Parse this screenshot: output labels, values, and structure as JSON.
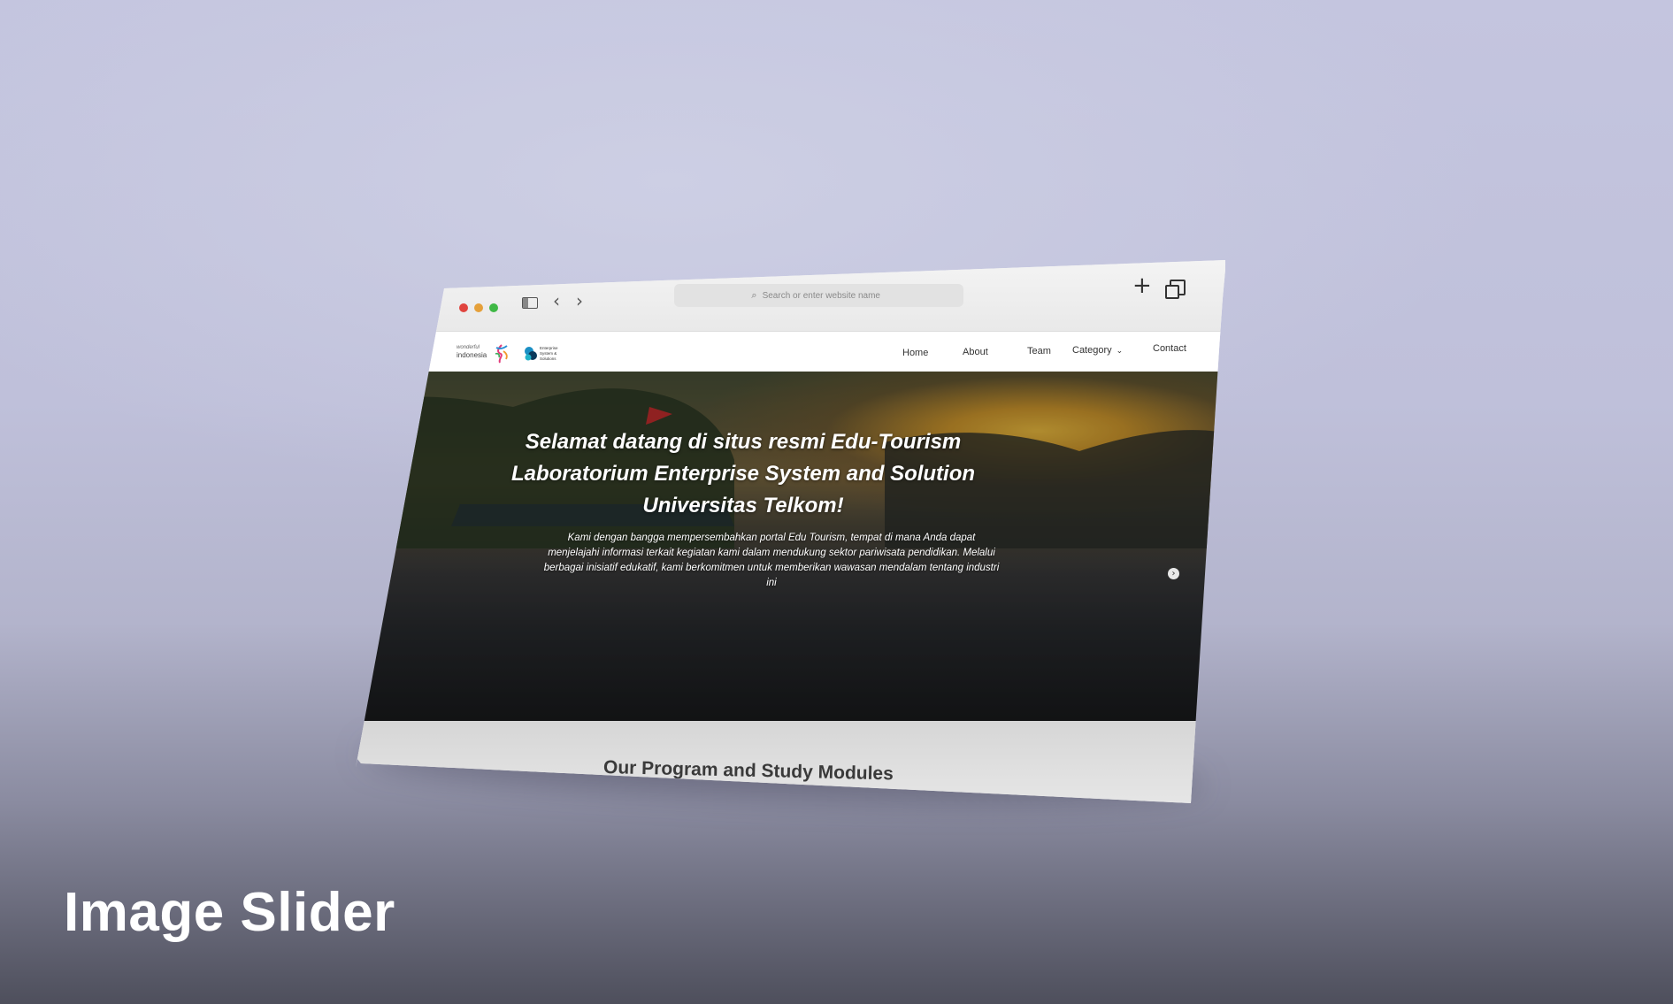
{
  "browser": {
    "address_placeholder": "Search or enter website name",
    "icons": {
      "sidebar": "sidebar-icon",
      "back": "chevron-left-icon",
      "forward": "chevron-right-icon",
      "search": "search-icon",
      "new_tab": "plus-icon",
      "tabs": "tabs-overview-icon"
    }
  },
  "site": {
    "logos": {
      "wonderful_line1": "wonderful",
      "wonderful_line2": "indonesia",
      "ess_line1": "Enterprise",
      "ess_line2": "System &",
      "ess_line3": "Solutions"
    },
    "nav": {
      "home": "Home",
      "about": "About",
      "team": "Team",
      "category": "Category",
      "contact": "Contact"
    },
    "hero": {
      "title": "Selamat datang di situs resmi Edu-Tourism Laboratorium Enterprise System and Solution Universitas Telkom!",
      "text": "Kami dengan bangga mempersembahkan portal Edu Tourism, tempat di mana Anda dapat menjelajahi informasi terkait kegiatan kami dalam mendukung sektor pariwisata pendidikan. Melalui berbagai inisiatif edukatif, kami berkomitmen untuk memberikan wawasan mendalam tentang industri ini",
      "prev_glyph": "‹",
      "next_glyph": "›"
    },
    "section_title": "Our Program and Study Modules"
  },
  "caption": "Image Slider",
  "colors": {
    "background": "#c3c4de",
    "traffic_red": "#e0443e",
    "traffic_yellow": "#e5a03a",
    "traffic_green": "#3fb845",
    "hero_text": "#ffffff"
  }
}
